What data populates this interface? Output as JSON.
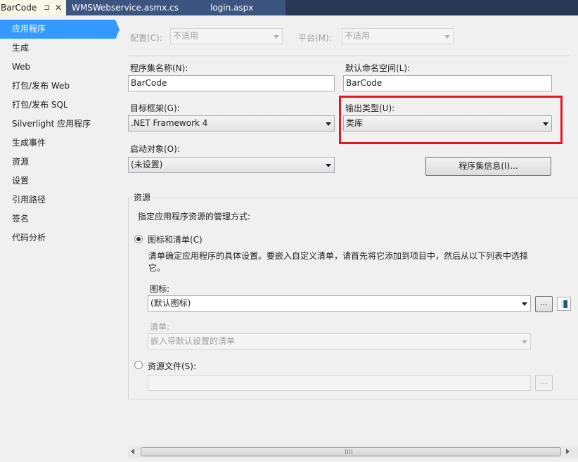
{
  "tabs": [
    {
      "label": "BarCode",
      "pin": "⊐",
      "close": "✕"
    },
    {
      "label": "WMSWebservice.asmx.cs"
    },
    {
      "label": "login.aspx"
    }
  ],
  "sidebar": {
    "items": [
      {
        "label": "应用程序"
      },
      {
        "label": "生成"
      },
      {
        "label": "Web"
      },
      {
        "label": "打包/发布 Web"
      },
      {
        "label": "打包/发布 SQL"
      },
      {
        "label": "Silverlight 应用程序"
      },
      {
        "label": "生成事件"
      },
      {
        "label": "资源"
      },
      {
        "label": "设置"
      },
      {
        "label": "引用路径"
      },
      {
        "label": "签名"
      },
      {
        "label": "代码分析"
      }
    ]
  },
  "config": {
    "config_label": "配置(C):",
    "config_value": "不适用",
    "platform_label": "平台(M):",
    "platform_value": "不适用"
  },
  "app": {
    "assembly_name_label": "程序集名称(N):",
    "assembly_name_value": "BarCode",
    "namespace_label": "默认命名空间(L):",
    "namespace_value": "BarCode",
    "target_framework_label": "目标框架(G):",
    "target_framework_value": ".NET Framework 4",
    "output_type_label": "输出类型(U):",
    "output_type_value": "类库",
    "startup_label": "启动对象(O):",
    "startup_value": "(未设置)",
    "assembly_info_button": "程序集信息(I)..."
  },
  "resources": {
    "group_title": "资源",
    "description": "指定应用程序资源的管理方式:",
    "icon_manifest_radio": "图标和清单(C)",
    "icon_manifest_text_line1": "清单确定应用程序的具体设置。要嵌入自定义清单，请首先将它添加到项目中，然后从以下列表中选择",
    "icon_manifest_text_line2": "它。",
    "icon_label": "图标:",
    "icon_value": "(默认图标)",
    "browse_button": "...",
    "manifest_label": "清单:",
    "manifest_value": "嵌入带默认设置的清单",
    "resource_file_radio": "资源文件(S):",
    "resource_file_value": "",
    "resource_browse_button": "..."
  },
  "colors": {
    "accent": "#3399ff",
    "highlight_box": "#e8171e",
    "tab_bar": "#293955"
  }
}
